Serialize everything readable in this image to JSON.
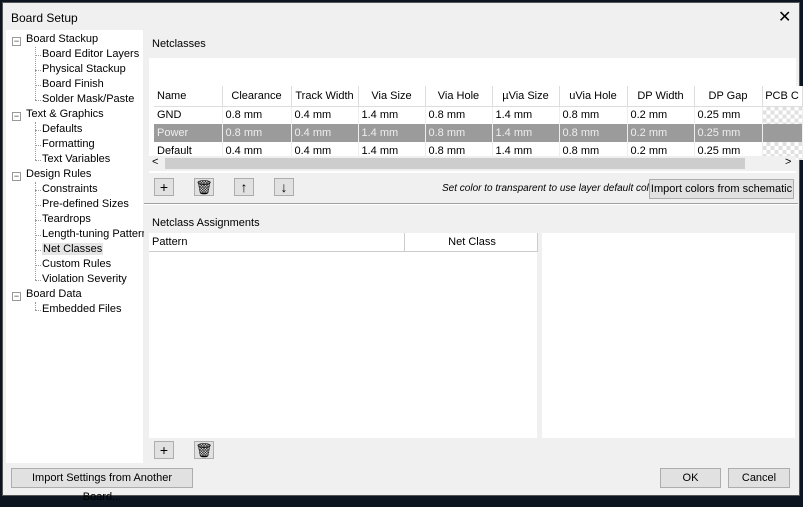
{
  "window": {
    "title": "Board Setup"
  },
  "tree": [
    {
      "label": "Board Stackup",
      "level": 0,
      "children": [
        {
          "label": "Board Editor Layers"
        },
        {
          "label": "Physical Stackup"
        },
        {
          "label": "Board Finish"
        },
        {
          "label": "Solder Mask/Paste"
        }
      ]
    },
    {
      "label": "Text & Graphics",
      "level": 0,
      "children": [
        {
          "label": "Defaults"
        },
        {
          "label": "Formatting"
        },
        {
          "label": "Text Variables"
        }
      ]
    },
    {
      "label": "Design Rules",
      "level": 0,
      "children": [
        {
          "label": "Constraints"
        },
        {
          "label": "Pre-defined Sizes"
        },
        {
          "label": "Teardrops"
        },
        {
          "label": "Length-tuning Patterns"
        },
        {
          "label": "Net Classes",
          "selected": true
        },
        {
          "label": "Custom Rules"
        },
        {
          "label": "Violation Severity"
        }
      ]
    },
    {
      "label": "Board Data",
      "level": 0,
      "children": [
        {
          "label": "Embedded Files"
        }
      ]
    }
  ],
  "netclasses": {
    "title": "Netclasses",
    "columns": [
      "Name",
      "Clearance",
      "Track Width",
      "Via Size",
      "Via Hole",
      "µVia Size",
      "uVia Hole",
      "DP Width",
      "DP Gap",
      "PCB C"
    ],
    "rows": [
      [
        "GND",
        "0.8 mm",
        "0.4 mm",
        "1.4 mm",
        "0.8 mm",
        "1.4 mm",
        "0.8 mm",
        "0.2 mm",
        "0.25 mm"
      ],
      [
        "Power",
        "0.8 mm",
        "0.4 mm",
        "1.4 mm",
        "0.8 mm",
        "1.4 mm",
        "0.8 mm",
        "0.2 mm",
        "0.25 mm"
      ],
      [
        "Default",
        "0.4 mm",
        "0.4 mm",
        "1.4 mm",
        "0.8 mm",
        "1.4 mm",
        "0.8 mm",
        "0.2 mm",
        "0.25 mm"
      ]
    ],
    "selected_row": 1,
    "hint": "Set color to transparent to use layer default color.",
    "import_colors": "Import colors from schematic"
  },
  "assignments": {
    "title": "Netclass Assignments",
    "columns": [
      "Pattern",
      "Net Class"
    ]
  },
  "footer": {
    "import_settings": "Import Settings from Another Board...",
    "ok": "OK",
    "cancel": "Cancel"
  }
}
